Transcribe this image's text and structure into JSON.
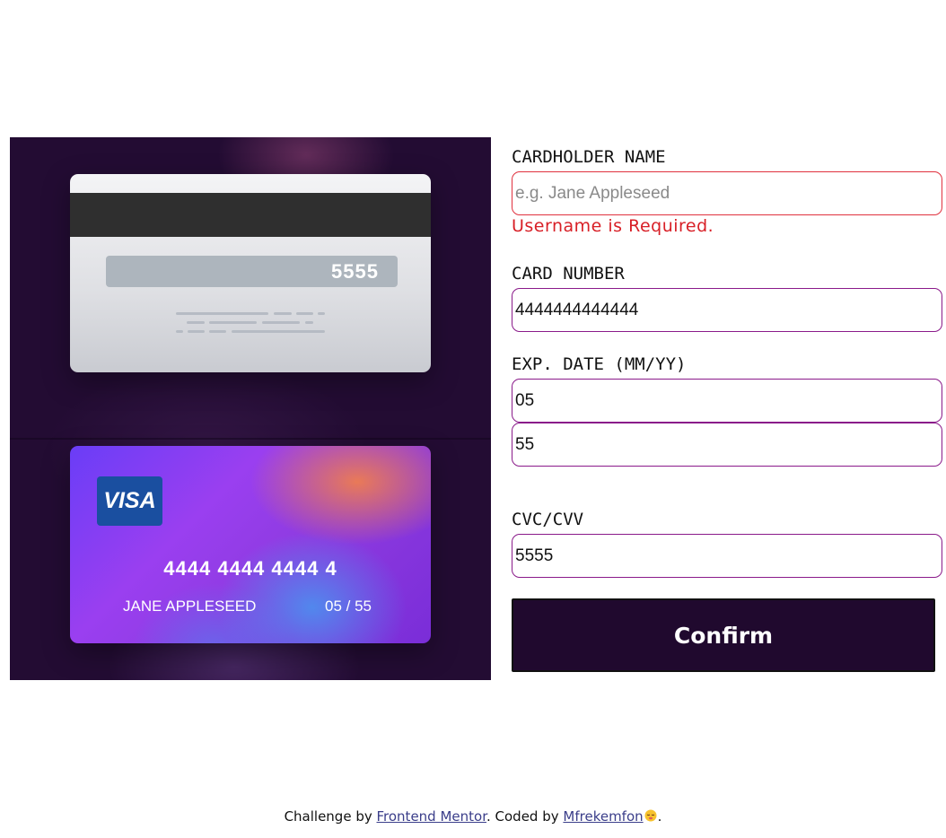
{
  "card_back": {
    "cvc": "5555"
  },
  "card_front": {
    "brand": "VISA",
    "number": "4444 4444 4444 4",
    "holder": "JANE APPLESEED",
    "expiry": "05 / 55"
  },
  "form": {
    "name_label": "CARDHOLDER NAME",
    "name_placeholder": "e.g. Jane Appleseed",
    "name_value": "",
    "name_error": "Username is Required.",
    "number_label": "CARD NUMBER",
    "number_value": "4444444444444",
    "exp_label": "EXP. DATE (MM/YY)",
    "exp_month_value": "05",
    "exp_year_value": "55",
    "cvc_label": "CVC/CVV",
    "cvc_value": "5555",
    "confirm_label": "Confirm"
  },
  "footer": {
    "prefix": "Challenge by ",
    "link1": "Frontend Mentor",
    "middle": ". Coded by ",
    "link2": "Mfrekemfon",
    "suffix": "."
  },
  "colors": {
    "panel_bg": "#230c33",
    "input_border": "#8a1a8a",
    "error": "#d81f26",
    "button_bg": "#20092e"
  }
}
